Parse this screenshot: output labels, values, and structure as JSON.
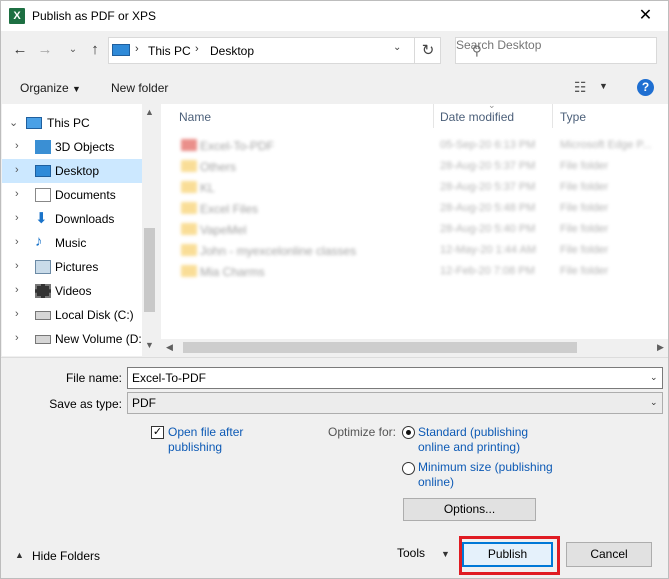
{
  "window": {
    "title": "Publish as PDF or XPS",
    "app_icon_letter": "X"
  },
  "nav": {
    "address_crumbs": [
      "This PC",
      "Desktop"
    ],
    "search_placeholder": "Search Desktop"
  },
  "toolbar": {
    "organize_label": "Organize",
    "new_folder_label": "New folder"
  },
  "tree": {
    "root": "This PC",
    "items": [
      "3D Objects",
      "Desktop",
      "Documents",
      "Downloads",
      "Music",
      "Pictures",
      "Videos",
      "Local Disk (C:)",
      "New Volume (D:"
    ],
    "selected": "Desktop"
  },
  "file_list": {
    "columns": [
      "Name",
      "Date modified",
      "Type"
    ],
    "rows": [
      {
        "name": "Excel-To-PDF",
        "date": "05-Sep-20 6:13 PM",
        "type": "Microsoft Edge P..."
      },
      {
        "name": "Others",
        "date": "28-Aug-20 5:37 PM",
        "type": "File folder"
      },
      {
        "name": "KL",
        "date": "28-Aug-20 5:37 PM",
        "type": "File folder"
      },
      {
        "name": "Excel Files",
        "date": "28-Aug-20 5:48 PM",
        "type": "File folder"
      },
      {
        "name": "VapeMel",
        "date": "28-Aug-20 5:40 PM",
        "type": "File folder"
      },
      {
        "name": "John - myexcelonline classes",
        "date": "12-May-20 1:44 AM",
        "type": "File folder"
      },
      {
        "name": "Mia Charms",
        "date": "12-Feb-20 7:08 PM",
        "type": "File folder"
      }
    ]
  },
  "form": {
    "file_name_label": "File name:",
    "file_name_value": "Excel-To-PDF",
    "save_type_label": "Save as type:",
    "save_type_value": "PDF",
    "open_after_label": "Open file after publishing",
    "open_after_checked": true,
    "optimize_label": "Optimize for:",
    "standard_label": "Standard (publishing online and printing)",
    "minimum_label": "Minimum size (publishing online)",
    "optimize_selected": "standard",
    "options_label": "Options..."
  },
  "footer": {
    "hide_folders_label": "Hide Folders",
    "tools_label": "Tools",
    "publish_label": "Publish",
    "cancel_label": "Cancel"
  },
  "colors": {
    "accent": "#0078d7",
    "highlight_box": "#e01b22",
    "link_blue": "#0d5ab5",
    "selection": "#cce8ff"
  }
}
